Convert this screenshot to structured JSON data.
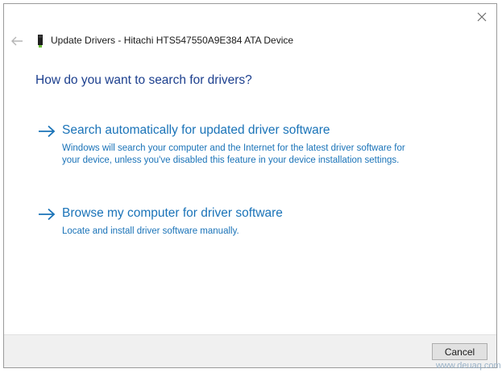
{
  "window": {
    "title": "Update Drivers - Hitachi HTS547550A9E384 ATA Device"
  },
  "icons": {
    "close": "close-icon",
    "back": "back-arrow-icon",
    "device": "drive-device-icon",
    "option_arrow": "arrow-right-icon"
  },
  "main": {
    "question": "How do you want to search for drivers?",
    "options": [
      {
        "title": "Search automatically for updated driver software",
        "description": "Windows will search your computer and the Internet for the latest driver software for your device, unless you've disabled this feature in your device installation settings."
      },
      {
        "title": "Browse my computer for driver software",
        "description": "Locate and install driver software manually."
      }
    ]
  },
  "footer": {
    "cancel_label": "Cancel"
  },
  "watermark": "www.deuaq.com",
  "colors": {
    "heading": "#1c3f8e",
    "link": "#1a73b8",
    "footer_bg": "#f0f0f0"
  }
}
